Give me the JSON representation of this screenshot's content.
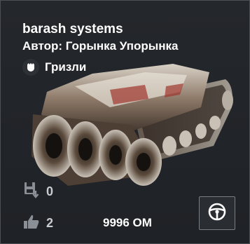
{
  "card": {
    "title": "barash systems",
    "author": "Автор: Горынка Упорынка",
    "faction": {
      "icon": "faction-emblem-icon",
      "label": "Гризли"
    },
    "vehicle_image": "armored-vehicle-render",
    "stats": {
      "saves": {
        "icon": "save-download-icon",
        "value": "0"
      },
      "likes": {
        "icon": "thumbs-up-icon",
        "value": "2"
      }
    },
    "price": "9996 ОМ",
    "drive_button": {
      "icon": "steering-wheel-icon"
    }
  },
  "colors": {
    "background": "#131416",
    "card": "#24272b",
    "border": "#4c5055",
    "text": "#ffffff",
    "stat_text": "#c9ccd0"
  }
}
